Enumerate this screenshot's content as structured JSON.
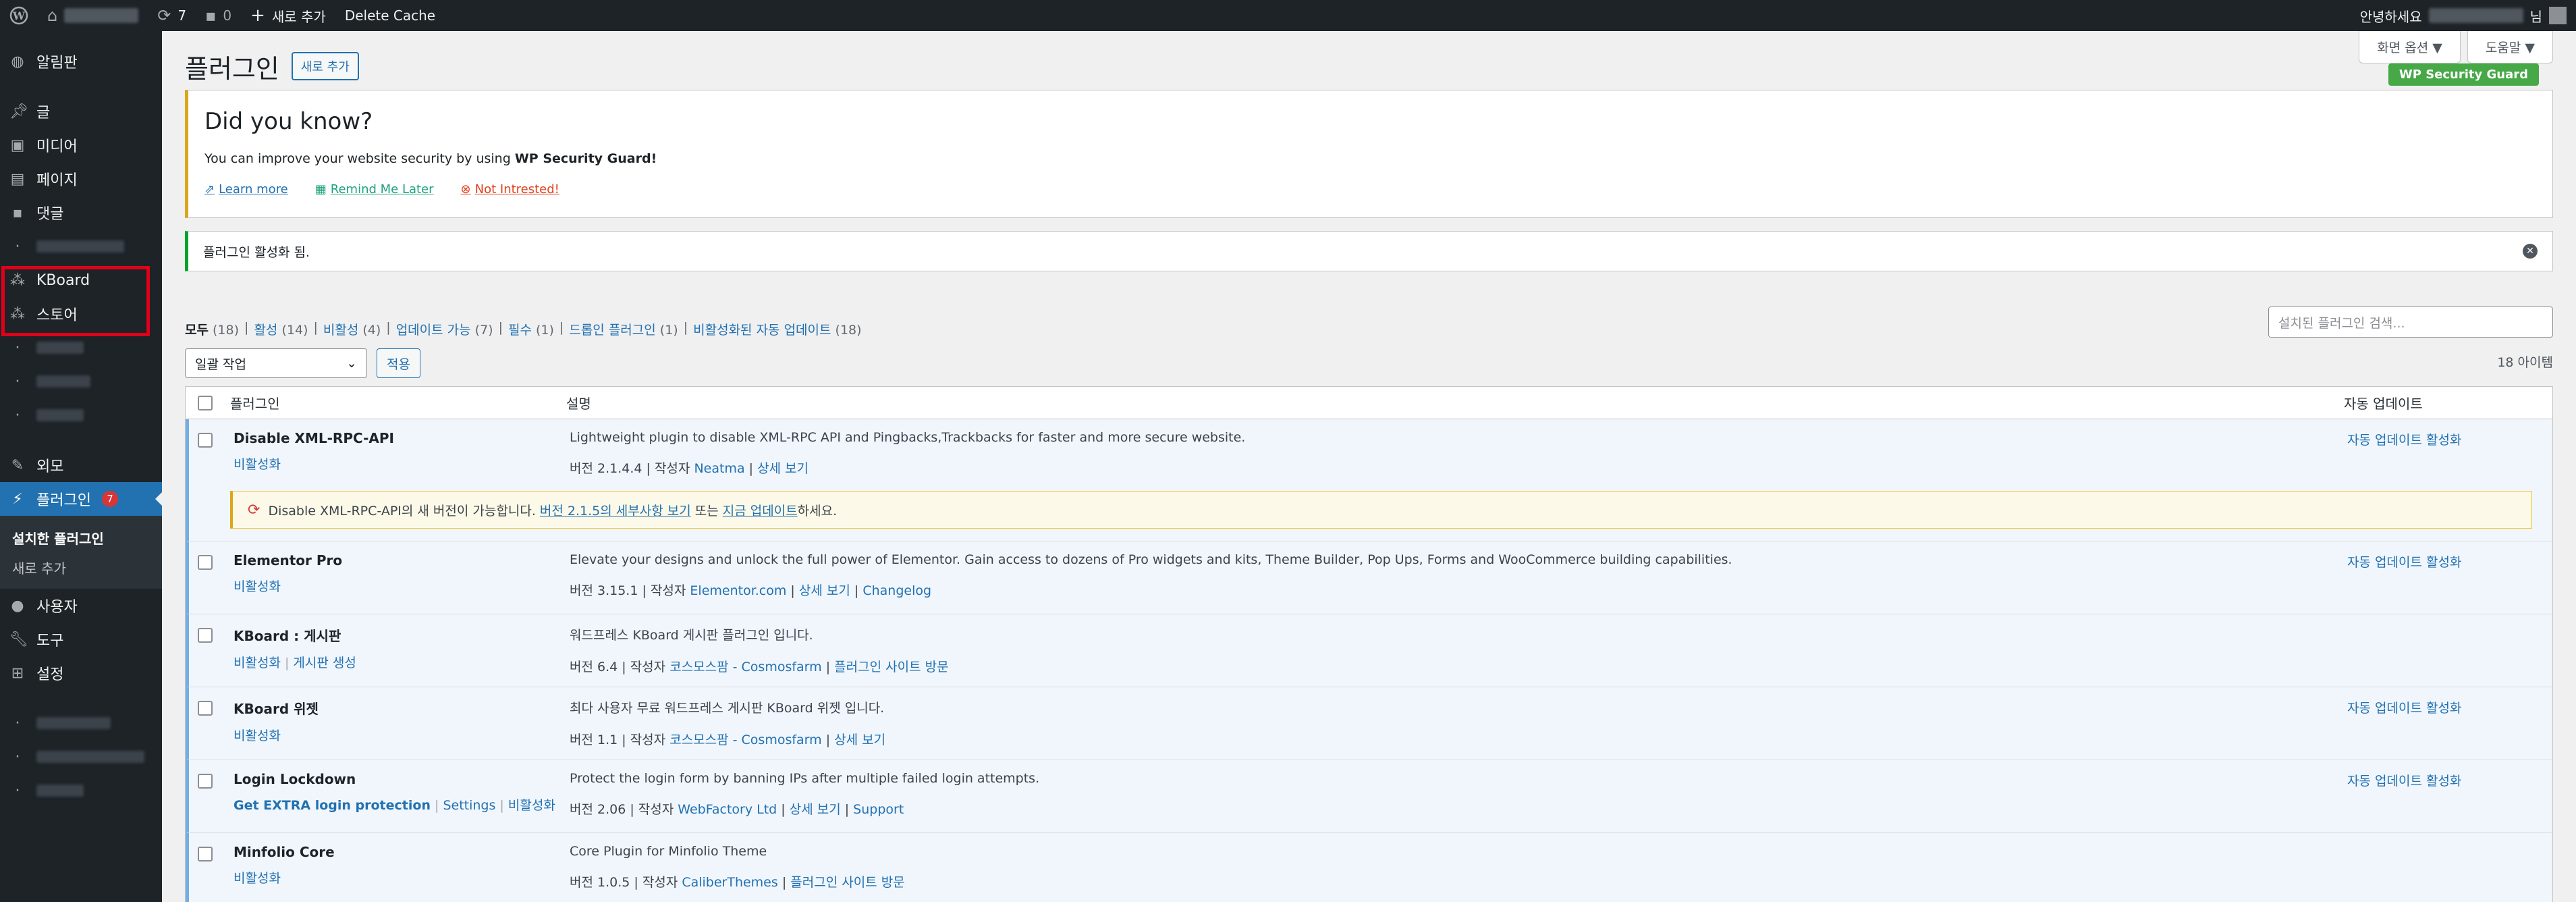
{
  "adminbar": {
    "update_count": "7",
    "comment_count": "0",
    "new_label": "새로 추가",
    "delete_cache": "Delete Cache",
    "greeting": "안녕하세요",
    "greeting_suffix": "님"
  },
  "sidebar": {
    "items": [
      {
        "label": "알림판",
        "icon": "dashboard-icon"
      },
      {
        "label": "글",
        "icon": "pin-icon"
      },
      {
        "label": "미디어",
        "icon": "media-icon"
      },
      {
        "label": "페이지",
        "icon": "page-icon"
      },
      {
        "label": "댓글",
        "icon": "comments-icon"
      },
      {
        "label": "KBoard",
        "icon": "kboard-icon"
      },
      {
        "label": "스토어",
        "icon": "store-icon"
      },
      {
        "label": "외모",
        "icon": "appearance-icon"
      },
      {
        "label": "플러그인",
        "icon": "plugins-icon",
        "badge": "7"
      },
      {
        "label": "사용자",
        "icon": "users-icon"
      },
      {
        "label": "도구",
        "icon": "tools-icon"
      },
      {
        "label": "설정",
        "icon": "settings-icon"
      }
    ],
    "submenu": [
      "설치한 플러그인",
      "새로 추가"
    ]
  },
  "screen_options": "화면 옵션 ▼",
  "help": "도움말 ▼",
  "page_title": "플러그인",
  "add_new": "새로 추가",
  "wpsg_badge": "WP Security Guard",
  "notice_dyk": {
    "heading": "Did you know?",
    "text_pre": "You can improve your website security by using ",
    "text_bold": "WP Security Guard!",
    "learn_more": "Learn more",
    "remind": "Remind Me Later",
    "not_interested": "Not Intrested!"
  },
  "notice_activated": "플러그인 활성화 됨.",
  "filters": [
    {
      "label": "모두",
      "count": "(18)"
    },
    {
      "label": "활성",
      "count": "(14)"
    },
    {
      "label": "비활성",
      "count": "(4)"
    },
    {
      "label": "업데이트 가능",
      "count": "(7)"
    },
    {
      "label": "필수",
      "count": "(1)"
    },
    {
      "label": "드롭인 플러그인",
      "count": "(1)"
    },
    {
      "label": "비활성화된 자동 업데이트",
      "count": "(18)"
    }
  ],
  "search_placeholder": "설치된 플러그인 검색...",
  "bulk_action": "일괄 작업",
  "apply": "적용",
  "item_count": "18 아이템",
  "columns": {
    "plugin": "플러그인",
    "description": "설명",
    "auto_update": "자동 업데이트"
  },
  "plugins": [
    {
      "name": "Disable XML-RPC-API",
      "actions": [
        "비활성화"
      ],
      "desc": "Lightweight plugin to disable XML-RPC API and Pingbacks,Trackbacks for faster and more secure website.",
      "meta_pre": "버전 2.1.4.4 | 작성자 ",
      "meta_links": [
        "Neatma",
        "상세 보기"
      ],
      "auto": "자동 업데이트 활성화"
    },
    {
      "name": "Elementor Pro",
      "actions": [
        "비활성화"
      ],
      "desc": "Elevate your designs and unlock the full power of Elementor. Gain access to dozens of Pro widgets and kits, Theme Builder, Pop Ups, Forms and WooCommerce building capabilities.",
      "meta_pre": "버전 3.15.1 | 작성자 ",
      "meta_links": [
        "Elementor.com",
        "상세 보기",
        "Changelog"
      ],
      "auto": "자동 업데이트 활성화"
    },
    {
      "name": "KBoard : 게시판",
      "actions": [
        "비활성화",
        "게시판 생성"
      ],
      "desc": "워드프레스 KBoard 게시판 플러그인 입니다.",
      "meta_pre": "버전 6.4 | 작성자 ",
      "meta_links": [
        "코스모스팜 - Cosmosfarm",
        "플러그인 사이트 방문"
      ],
      "auto": ""
    },
    {
      "name": "KBoard 위젯",
      "actions": [
        "비활성화"
      ],
      "desc": "최다 사용자 무료 워드프레스 게시판 KBoard 위젯 입니다.",
      "meta_pre": "버전 1.1 | 작성자 ",
      "meta_links": [
        "코스모스팜 - Cosmosfarm",
        "상세 보기"
      ],
      "auto": "자동 업데이트 활성화"
    },
    {
      "name": "Login Lockdown",
      "actions": [
        "Get EXTRA login protection",
        "Settings",
        "비활성화"
      ],
      "desc": "Protect the login form by banning IPs after multiple failed login attempts.",
      "meta_pre": "버전 2.06 | 작성자 ",
      "meta_links": [
        "WebFactory Ltd",
        "상세 보기",
        "Support"
      ],
      "auto": "자동 업데이트 활성화"
    },
    {
      "name": "Minfolio Core",
      "actions": [
        "비활성화"
      ],
      "desc": "Core Plugin for Minfolio Theme",
      "meta_pre": "버전 1.0.5 | 작성자 ",
      "meta_links": [
        "CaliberThemes",
        "플러그인 사이트 방문"
      ],
      "auto": ""
    }
  ],
  "update_notice": {
    "pre": "Disable XML-RPC-API의 새 버전이 가능합니다. ",
    "link1": "버전 2.1.5의 세부사항 보기",
    "mid": " 또는 ",
    "link2": "지금 업데이트",
    "post": "하세요."
  },
  "colors": {
    "adminbar": "#1d2327",
    "accent": "#2271b1",
    "highlight_box": "#e0001a",
    "success": "#00a32a",
    "warning": "#dba617"
  }
}
